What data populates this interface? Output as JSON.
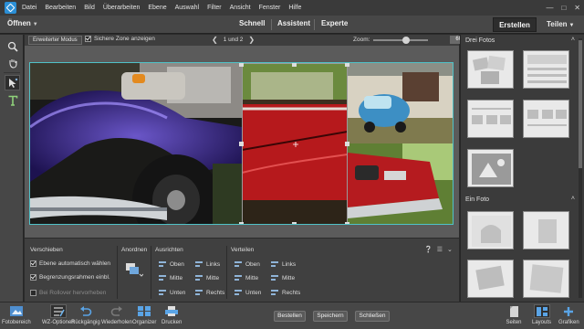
{
  "menu": {
    "items": [
      "Datei",
      "Bearbeiten",
      "Bild",
      "Überarbeiten",
      "Ebene",
      "Auswahl",
      "Filter",
      "Ansicht",
      "Fenster",
      "Hilfe"
    ]
  },
  "modebar": {
    "open_label": "Öffnen",
    "tabs": [
      "Schnell",
      "Assistent",
      "Experte"
    ],
    "create_label": "Erstellen",
    "share_label": "Teilen"
  },
  "optbar": {
    "expert_mode_label": "Erweiterter Modus",
    "safe_zone_label": "Sichere Zone anzeigen",
    "safe_zone_checked": true,
    "page_indicator": "1 und 2",
    "zoom_label": "Zoom:",
    "zoom_value": "60%",
    "zoom_fraction": 0.6
  },
  "options": {
    "move_title": "Verschieben",
    "auto_select_label": "Ebene automatisch wählen",
    "bounding_box_label": "Begrenzungsrahmen einbl.",
    "rollover_label": "Bei Rollover hervorheben",
    "arrange_title": "Anordnen",
    "align_title": "Ausrichten",
    "align_items": [
      "Oben",
      "Links",
      "Mitte",
      "Mitte",
      "Unten",
      "Rechts"
    ],
    "distribute_title": "Verteilen",
    "distribute_items": [
      "Oben",
      "Links",
      "Mitte",
      "Mitte",
      "Unten",
      "Rechts"
    ]
  },
  "rightpanel": {
    "section1_title": "Drei Fotos",
    "section2_title": "Ein Foto"
  },
  "taskbar": {
    "items": [
      "Fotobereich",
      "WZ-Optionen",
      "Rückgängig",
      "Wiederholen",
      "Organizer",
      "Drucken"
    ],
    "buttons": [
      "Bestellen",
      "Speichern",
      "Schließen"
    ],
    "right_items": [
      "Seiten",
      "Layouts",
      "Grafiken"
    ]
  },
  "colors": {
    "accent": "#2b8fd6",
    "selection": "#4fc2c7",
    "panel_bg": "#474747"
  }
}
